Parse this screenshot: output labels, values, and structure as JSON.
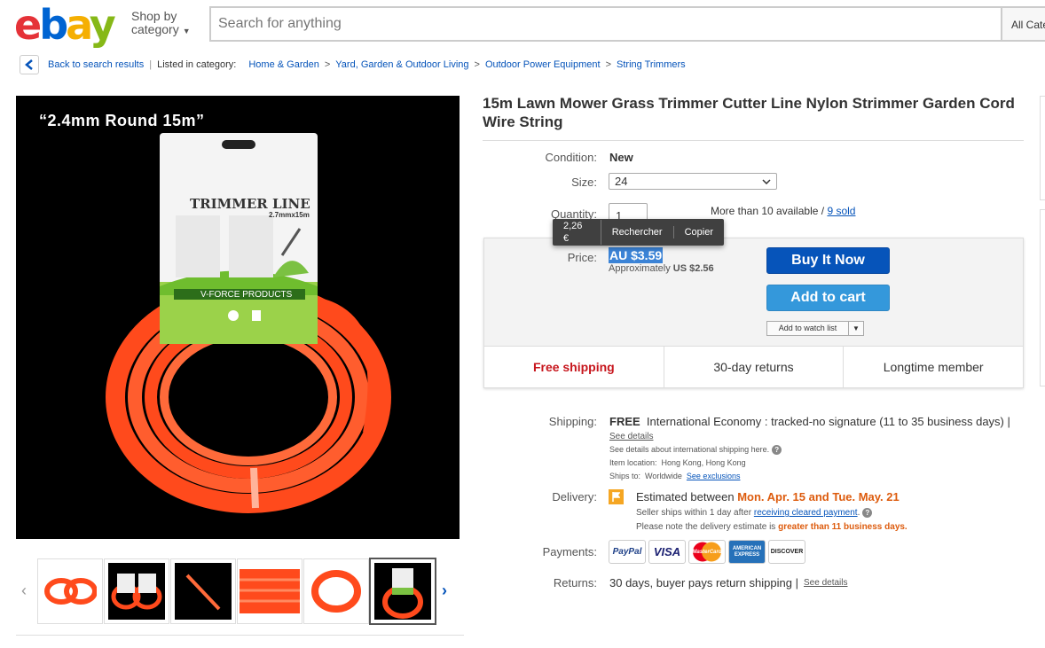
{
  "header": {
    "logo": {
      "e": "e",
      "b": "b",
      "a": "a",
      "y": "y"
    },
    "shop_by": "Shop by",
    "category": "category",
    "search_placeholder": "Search for anything",
    "search_category": "All Categories"
  },
  "breadcrumb": {
    "back": "Back to search results",
    "listed_in": "Listed in category:",
    "items": [
      "Home & Garden",
      "Yard, Garden & Outdoor Living",
      "Outdoor Power Equipment",
      "String Trimmers"
    ]
  },
  "image": {
    "caption": "“2.4mm Round 15m”",
    "package_title": "TRIMMER LINE",
    "package_sub": "2.7mmx15m",
    "package_brand": "V-FORCE PRODUCTS"
  },
  "product": {
    "title": "15m Lawn Mower Grass Trimmer Cutter Line Nylon Strimmer Garden Cord Wire String",
    "condition_label": "Condition:",
    "condition": "New",
    "size_label": "Size:",
    "size": "24",
    "quantity_label": "Quantity:",
    "quantity": "1",
    "available": "More than 10 available /",
    "sold": "9 sold",
    "price_label": "Price:",
    "price": "AU $3.59",
    "approx_prefix": "Approximately",
    "approx_value": "US $2.56",
    "buy_now": "Buy It Now",
    "add_to_cart": "Add to cart",
    "watch": "Add to watch list",
    "features": [
      "Free shipping",
      "30-day returns",
      "Longtime member"
    ]
  },
  "tooltip": {
    "items": [
      "2,26 €",
      "Rechercher",
      "Copier"
    ]
  },
  "shipping": {
    "label": "Shipping:",
    "free": "FREE",
    "method": "International Economy : tracked-no signature (11 to 35 business days) |",
    "see_details": "See details",
    "intl_note": "See details about international shipping here.",
    "location_label": "Item location:",
    "location": "Hong Kong, Hong Kong",
    "ships_to_label": "Ships to:",
    "ships_to": "Worldwide",
    "see_exclusions": "See exclusions"
  },
  "delivery": {
    "label": "Delivery:",
    "estimated": "Estimated between",
    "dates": "Mon. Apr. 15 and Tue. May. 21",
    "seller_ships": "Seller ships within 1 day after",
    "receiving": "receiving cleared payment",
    "note": "Please note the delivery estimate is",
    "note_em": "greater than 11 business days."
  },
  "payments": {
    "label": "Payments:",
    "cards": [
      "PayPal",
      "VISA",
      "MasterCard",
      "AMERICAN EXPRESS",
      "DISCOVER"
    ]
  },
  "returns": {
    "label": "Returns:",
    "text": "30 days, buyer pays return shipping |",
    "see_details": "See details"
  },
  "colors": {
    "link": "#0654ba",
    "buy_now": "#0654ba",
    "add_to_cart": "#3498db",
    "free_shipping": "#c7161d",
    "delivery_date": "#dd5b0d",
    "line": "#ff4a1c"
  }
}
